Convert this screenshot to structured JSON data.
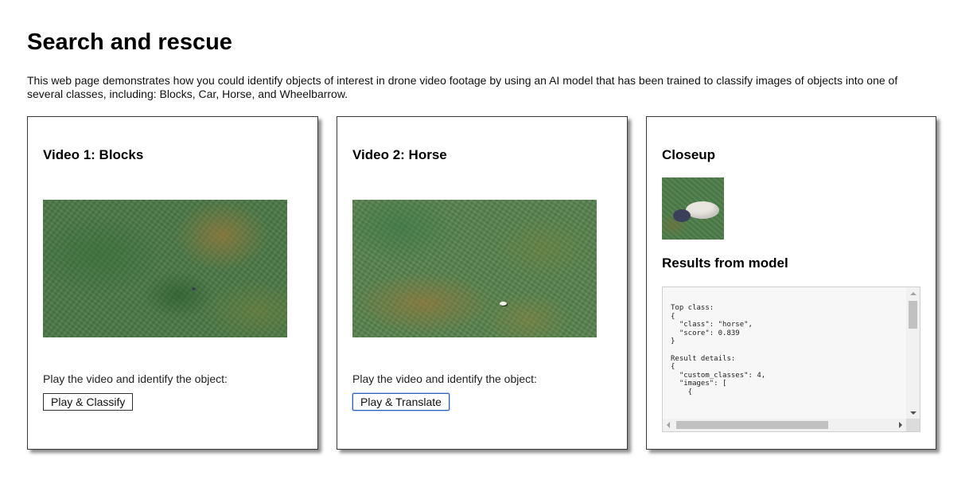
{
  "page": {
    "title": "Search and rescue",
    "intro": "This web page demonstrates how you could identify objects of interest in drone video footage by using an AI model that has been trained to classify images of objects into one of several classes, including: Blocks, Car, Horse, and Wheelbarrow."
  },
  "panels": [
    {
      "title": "Video 1: Blocks",
      "prompt": "Play the video and identify the object:",
      "button_label": "Play & Classify"
    },
    {
      "title": "Video 2: Horse",
      "prompt": "Play the video and identify the object:",
      "button_label": "Play & Translate"
    }
  ],
  "closeup": {
    "title": "Closeup",
    "results_title": "Results from model",
    "results_text": "Top class:\n{\n  \"class\": \"horse\",\n  \"score\": 0.839\n}\n\nResult details:\n{\n  \"custom_classes\": 4,\n  \"images\": [\n    {"
  },
  "colors": {
    "panel_border": "#3a3a3a",
    "button_focus": "#2a62b8",
    "results_background": "#f7f7f7"
  }
}
